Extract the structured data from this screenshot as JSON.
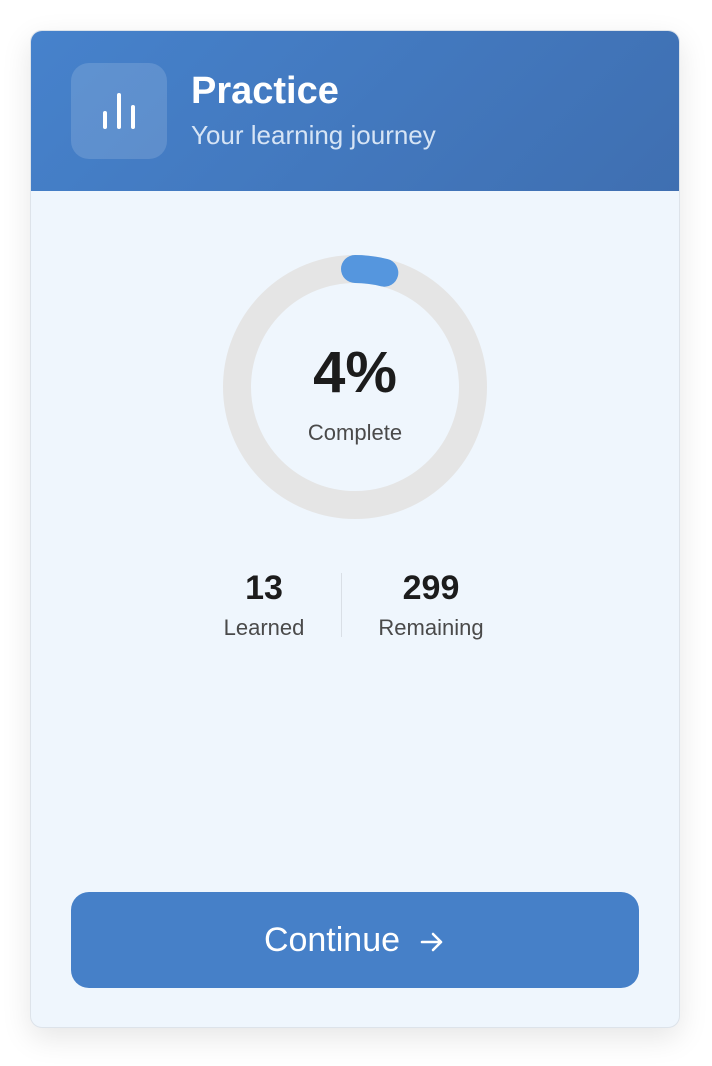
{
  "header": {
    "title": "Practice",
    "subtitle": "Your learning journey",
    "icon": "bar-chart-icon"
  },
  "progress": {
    "percent_text": "4%",
    "percent_value": 4,
    "label": "Complete",
    "track_color": "#e5e5e5",
    "fill_color": "#5596de"
  },
  "stats": {
    "learned": {
      "value": "13",
      "label": "Learned"
    },
    "remaining": {
      "value": "299",
      "label": "Remaining"
    }
  },
  "actions": {
    "continue_label": "Continue",
    "continue_icon": "arrow-right-icon"
  },
  "colors": {
    "accent": "#4680c8",
    "header_start": "#4682cc",
    "header_end": "#3f6fb1",
    "card_bg": "#eff6fd"
  }
}
